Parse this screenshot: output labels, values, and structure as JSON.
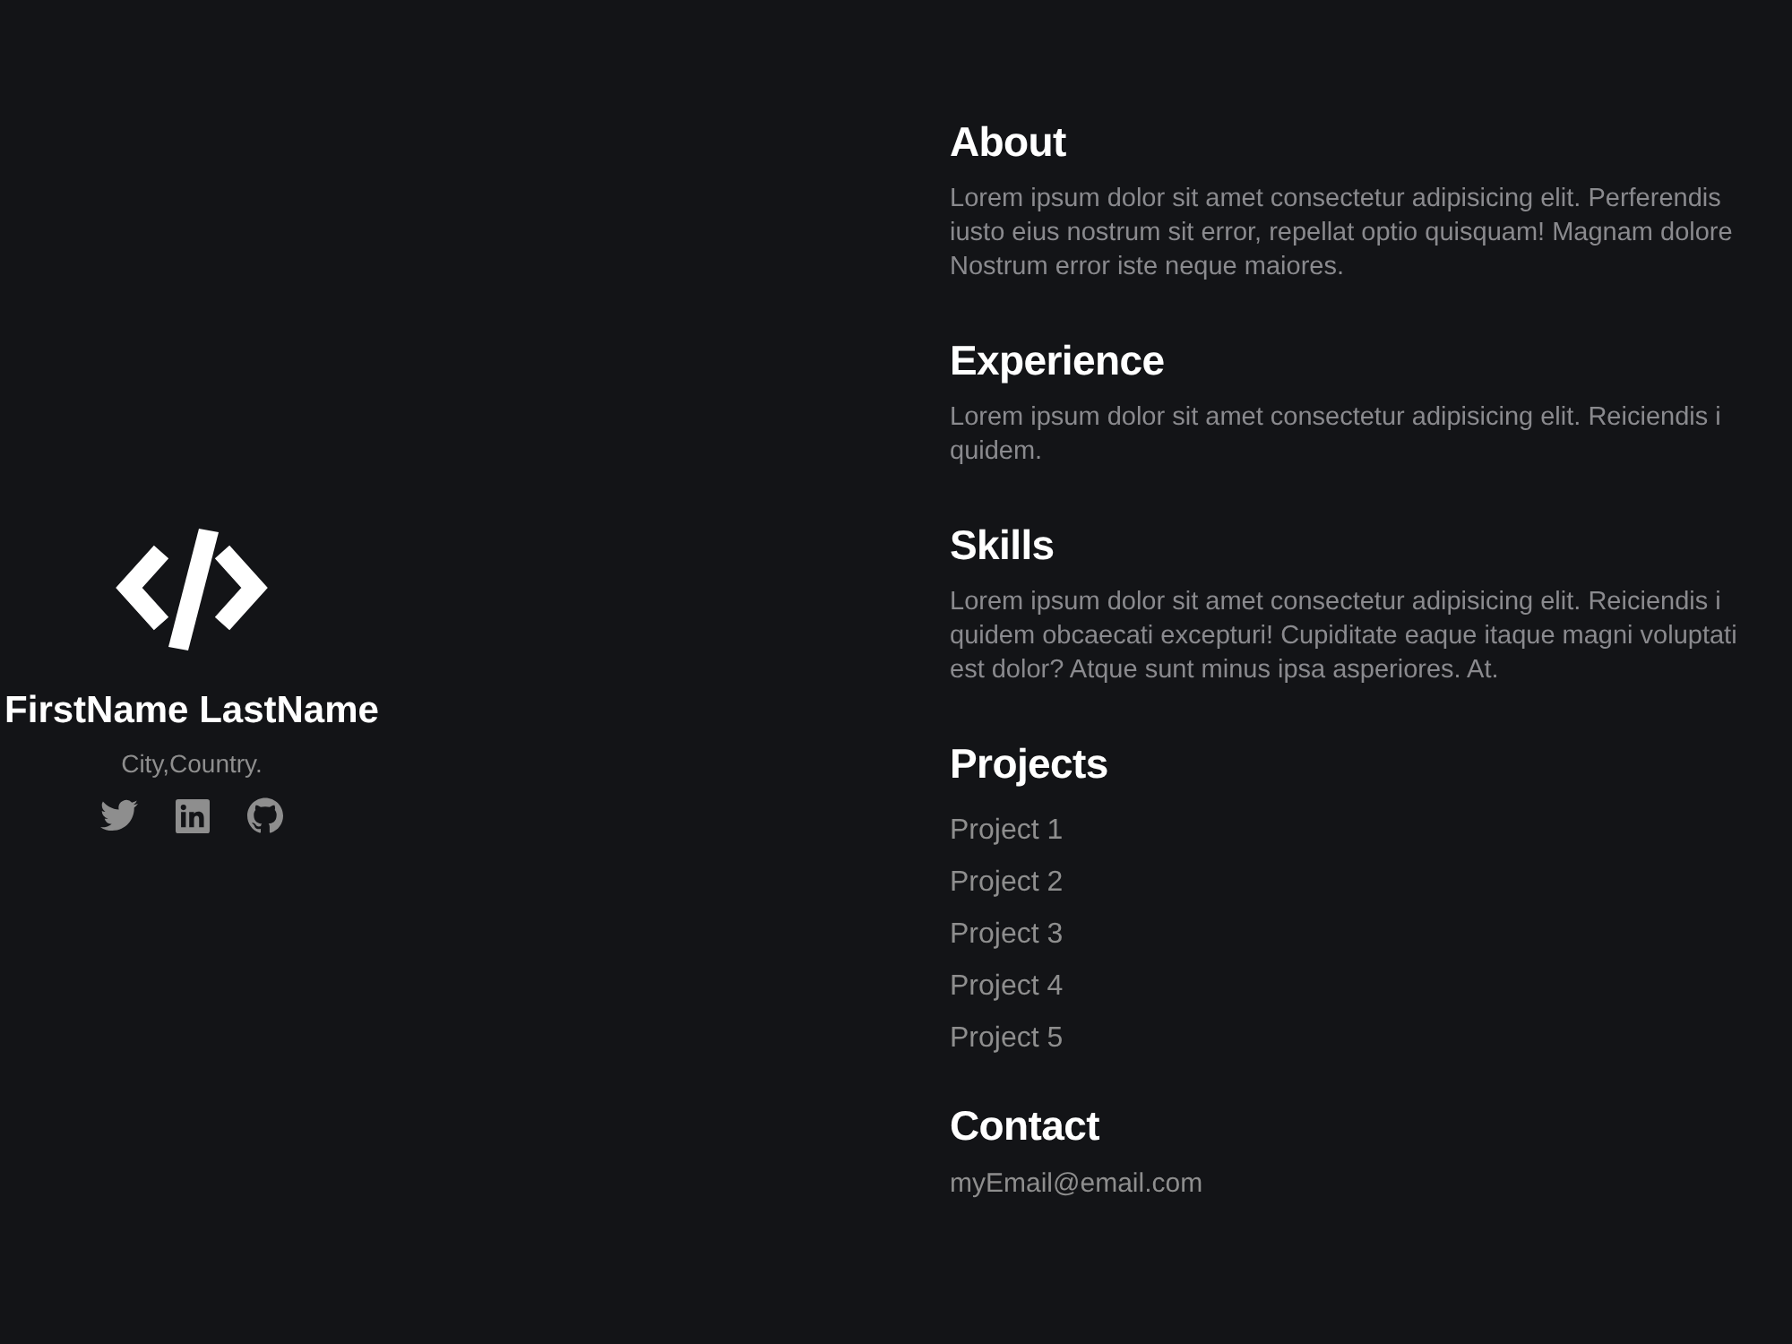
{
  "profile": {
    "name": "FirstName LastName",
    "location": "City,Country."
  },
  "sections": [
    {
      "heading": "About",
      "kind": "paragraph",
      "lines": [
        "Lorem ipsum dolor sit amet consectetur adipisicing elit. Perferendis",
        "iusto eius nostrum sit error, repellat optio quisquam! Magnam dolore",
        "Nostrum error iste neque maiores."
      ]
    },
    {
      "heading": "Experience",
      "kind": "paragraph",
      "lines": [
        "Lorem ipsum dolor sit amet consectetur adipisicing elit. Reiciendis i",
        "quidem."
      ]
    },
    {
      "heading": "Skills",
      "kind": "paragraph",
      "lines": [
        "Lorem ipsum dolor sit amet consectetur adipisicing elit. Reiciendis i",
        "quidem obcaecati excepturi! Cupiditate eaque itaque magni voluptati",
        "est dolor? Atque sunt minus ipsa asperiores. At."
      ]
    },
    {
      "heading": "Projects",
      "kind": "list",
      "items": [
        "Project 1",
        "Project 2",
        "Project 3",
        "Project 4",
        "Project 5"
      ]
    },
    {
      "heading": "Contact",
      "kind": "email",
      "lines": [
        "myEmail@email.com"
      ]
    }
  ]
}
